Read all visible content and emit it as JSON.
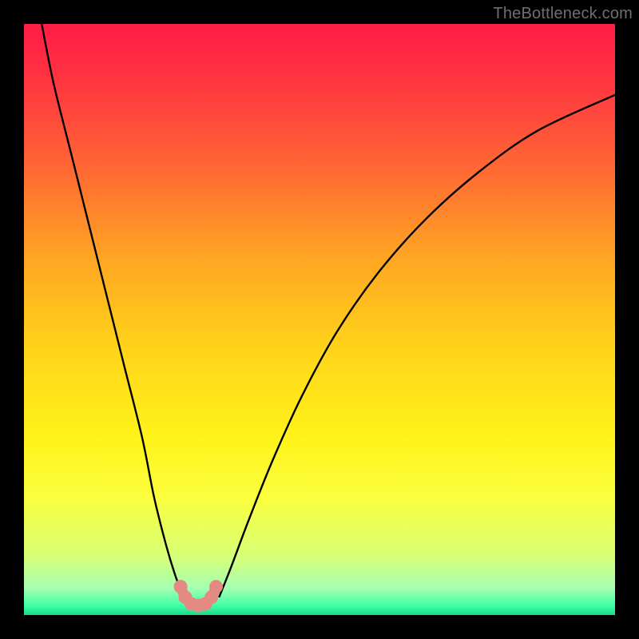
{
  "watermark": "TheBottleneck.com",
  "colors": {
    "frame": "#000000",
    "curve_stroke": "#000000",
    "marker_fill": "#e38a83",
    "gradient_stops": [
      {
        "offset": 0.0,
        "color": "#ff1c46"
      },
      {
        "offset": 0.1,
        "color": "#ff3640"
      },
      {
        "offset": 0.25,
        "color": "#ff6a33"
      },
      {
        "offset": 0.4,
        "color": "#ffa723"
      },
      {
        "offset": 0.55,
        "color": "#ffd41a"
      },
      {
        "offset": 0.7,
        "color": "#fff31a"
      },
      {
        "offset": 0.8,
        "color": "#fbff3e"
      },
      {
        "offset": 0.9,
        "color": "#d7ff76"
      },
      {
        "offset": 0.955,
        "color": "#a4ffb1"
      },
      {
        "offset": 0.985,
        "color": "#3effa7"
      },
      {
        "offset": 1.0,
        "color": "#17d885"
      }
    ]
  },
  "chart_data": {
    "type": "line",
    "title": "",
    "xlabel": "",
    "ylabel": "",
    "xlim": [
      0,
      100
    ],
    "ylim": [
      0,
      100
    ],
    "grid": false,
    "legend": false,
    "series": [
      {
        "name": "left-branch",
        "x": [
          3,
          5,
          8,
          11,
          14,
          17,
          20,
          22,
          24,
          25.5,
          27
        ],
        "y": [
          100,
          90,
          78,
          66,
          54,
          42,
          30,
          20,
          12,
          7,
          3
        ]
      },
      {
        "name": "right-branch",
        "x": [
          33,
          35,
          38,
          42,
          47,
          53,
          60,
          68,
          77,
          87,
          100
        ],
        "y": [
          3,
          8,
          16,
          26,
          37,
          48,
          58,
          67,
          75,
          82,
          88
        ]
      }
    ],
    "u_markers": {
      "name": "valley-markers",
      "x": [
        26.5,
        27.3,
        28.3,
        29.5,
        30.7,
        31.7,
        32.5
      ],
      "y": [
        4.8,
        3.0,
        1.9,
        1.6,
        1.9,
        3.0,
        4.8
      ]
    }
  }
}
